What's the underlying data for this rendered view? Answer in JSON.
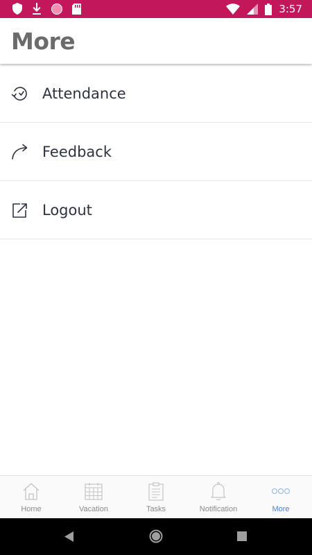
{
  "status_bar": {
    "time": "3:57"
  },
  "header": {
    "title": "More"
  },
  "menu": {
    "items": [
      {
        "label": "Attendance",
        "icon": "attendance-clock-icon"
      },
      {
        "label": "Feedback",
        "icon": "feedback-arrow-icon"
      },
      {
        "label": "Logout",
        "icon": "logout-icon"
      }
    ]
  },
  "bottom_nav": {
    "items": [
      {
        "label": "Home",
        "icon": "home-icon"
      },
      {
        "label": "Vacation",
        "icon": "calendar-icon"
      },
      {
        "label": "Tasks",
        "icon": "clipboard-icon"
      },
      {
        "label": "Notification",
        "icon": "bell-icon"
      },
      {
        "label": "More",
        "icon": "more-dots-icon",
        "active": true
      }
    ],
    "active_color": "#4a7fd6"
  },
  "colors": {
    "status_bar": "#c2185b",
    "title": "#6b6b6b",
    "menu_text": "#2d3340"
  }
}
